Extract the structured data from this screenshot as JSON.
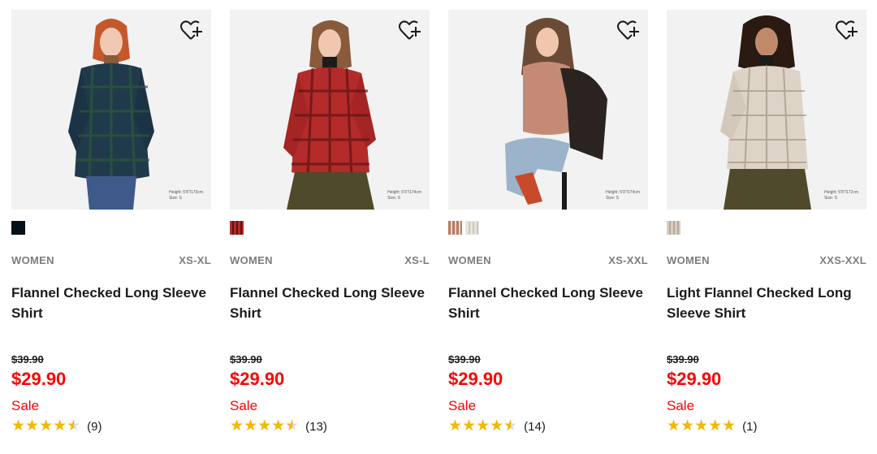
{
  "products": [
    {
      "gender": "WOMEN",
      "sizes": "XS-XL",
      "name": "Flannel Checked Long Sleeve Shirt",
      "original_price": "$39.90",
      "sale_price": "$29.90",
      "sale_label": "Sale",
      "rating": 4.5,
      "review_count": "(9)",
      "model_height": "Height: 5'8\"/173cm",
      "model_size": "Size: S",
      "wishlist_icon": "heart-plus-icon",
      "swatches": [
        {
          "color": "#1f3a4f",
          "pattern": "dark-check"
        }
      ]
    },
    {
      "gender": "WOMEN",
      "sizes": "XS-L",
      "name": "Flannel Checked Long Sleeve Shirt",
      "original_price": "$39.90",
      "sale_price": "$29.90",
      "sale_label": "Sale",
      "rating": 4.5,
      "review_count": "(13)",
      "model_height": "Height: 5'9\"/174cm",
      "model_size": "Size: S",
      "wishlist_icon": "heart-plus-icon",
      "swatches": [
        {
          "color": "#b52a2a",
          "pattern": "red-check"
        }
      ]
    },
    {
      "gender": "WOMEN",
      "sizes": "XS-XXL",
      "name": "Flannel Checked Long Sleeve Shirt",
      "original_price": "$39.90",
      "sale_price": "$29.90",
      "sale_label": "Sale",
      "rating": 4.5,
      "review_count": "(14)",
      "model_height": "Height: 5'9\"/174cm",
      "model_size": "Size: S",
      "wishlist_icon": "heart-plus-icon",
      "swatches": [
        {
          "color": "#b97a64",
          "pattern": "brown-check"
        },
        {
          "color": "#e2ddd4",
          "pattern": "light-check"
        }
      ]
    },
    {
      "gender": "WOMEN",
      "sizes": "XXS-XXL",
      "name": "Light Flannel Checked Long Sleeve Shirt",
      "original_price": "$39.90",
      "sale_price": "$29.90",
      "sale_label": "Sale",
      "rating": 5,
      "review_count": "(1)",
      "model_height": "Height: 5'8\"/172cm",
      "model_size": "Size: S",
      "wishlist_icon": "heart-plus-icon",
      "swatches": [
        {
          "color": "#d8cfc3",
          "pattern": "beige-check"
        }
      ]
    }
  ],
  "colors": {
    "sale_red": "#ff0000",
    "star_gold": "#f4b800",
    "muted_gray": "#7d7d7d",
    "photo_bg": "#f2f2f2"
  }
}
